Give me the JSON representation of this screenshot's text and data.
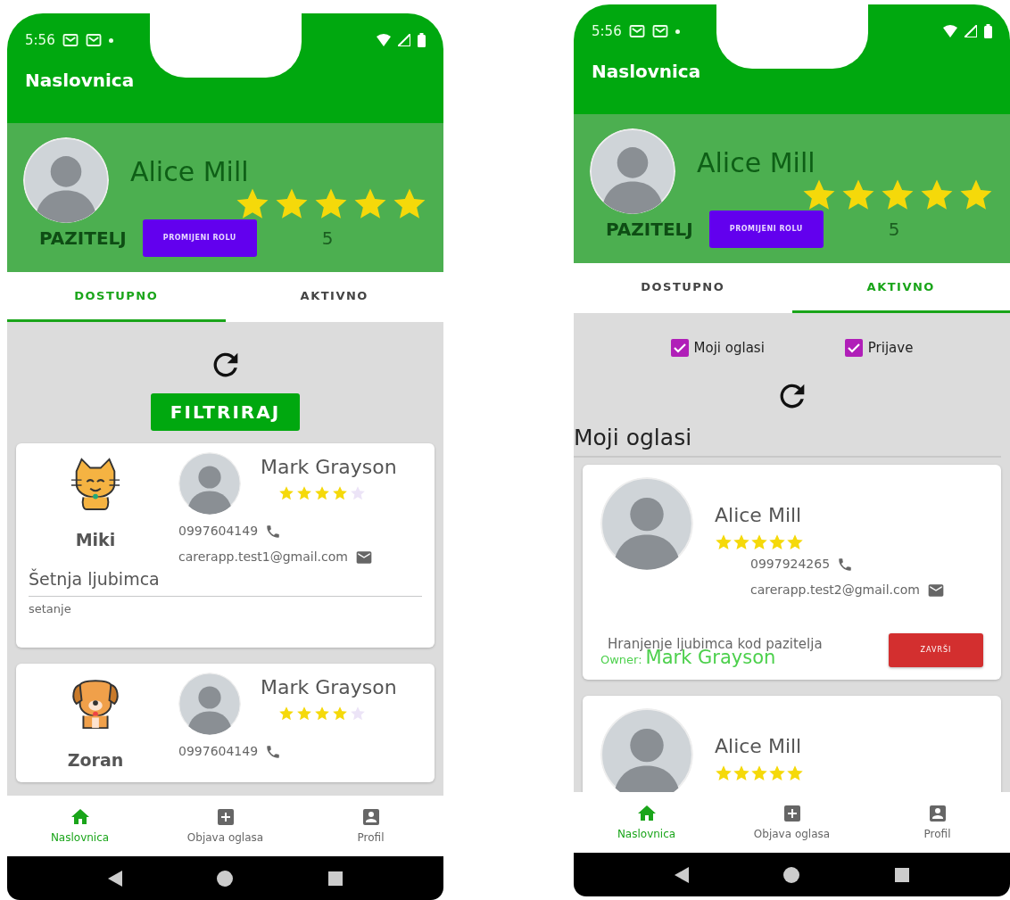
{
  "phones": [
    {
      "status_bar": {
        "time": "5:56"
      },
      "app_bar": {
        "title": "Naslovnica"
      },
      "profile": {
        "name": "Alice Mill",
        "stars": 5,
        "role": "PAZITELJ",
        "button": "PROMIJENI ROLU",
        "rating": "5"
      },
      "tabs": [
        {
          "label": "DOSTUPNO",
          "selected": true
        },
        {
          "label": "AKTIVNO",
          "selected": false
        }
      ],
      "filter_button": "FILTRIRAJ",
      "cards": [
        {
          "kind": "listing",
          "pet": {
            "kind": "cat",
            "name": "Miki"
          },
          "owner": "Mark Grayson",
          "stars": 4,
          "phone": "0997604149",
          "email": "carerapp.test1@gmail.com",
          "title": "Šetnja ljubimca",
          "description": "setanje"
        },
        {
          "kind": "listing",
          "pet": {
            "kind": "dog",
            "name": "Zoran"
          },
          "owner": "Mark Grayson",
          "stars": 4,
          "phone": "0997604149"
        }
      ],
      "bottom_nav": [
        {
          "label": "Naslovnica",
          "selected": true
        },
        {
          "label": "Objava oglasa",
          "selected": false
        },
        {
          "label": "Profil",
          "selected": false
        }
      ]
    },
    {
      "status_bar": {
        "time": "5:56"
      },
      "app_bar": {
        "title": "Naslovnica"
      },
      "profile": {
        "name": "Alice Mill",
        "stars": 5,
        "role": "PAZITELJ",
        "button": "PROMIJENI ROLU",
        "rating": "5"
      },
      "tabs": [
        {
          "label": "DOSTUPNO",
          "selected": false
        },
        {
          "label": "AKTIVNO",
          "selected": true
        }
      ],
      "filters": [
        {
          "label": "Moji oglasi",
          "checked": true
        },
        {
          "label": "Prijave",
          "checked": true
        }
      ],
      "section_title": "Moji oglasi",
      "cards": [
        {
          "kind": "mine",
          "name": "Alice Mill",
          "stars": 5,
          "phone": "0997924265",
          "email": "carerapp.test2@gmail.com",
          "title": "Hranjenje ljubimca kod pazitelja",
          "owner_label": "Owner:",
          "owner": "Mark Grayson",
          "button": "ZAVRŠI"
        },
        {
          "kind": "mine",
          "name": "Alice Mill",
          "stars": 5
        }
      ],
      "bottom_nav": [
        {
          "label": "Naslovnica",
          "selected": true
        },
        {
          "label": "Objava oglasa",
          "selected": false
        },
        {
          "label": "Profil",
          "selected": false
        }
      ]
    }
  ]
}
